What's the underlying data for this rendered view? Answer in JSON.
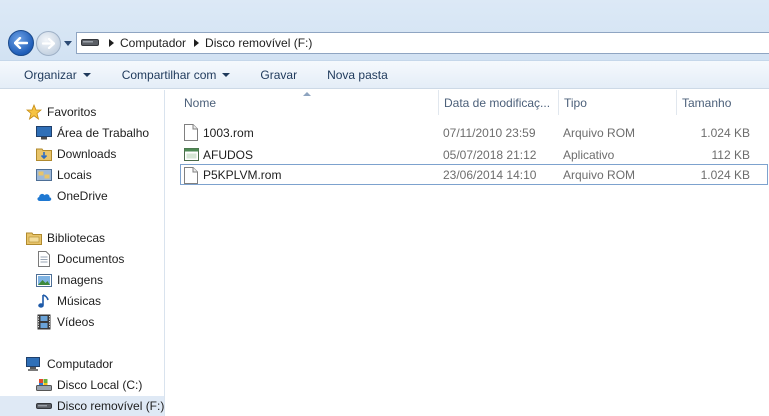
{
  "address": {
    "crumbs": [
      "Computador",
      "Disco removível (F:)"
    ]
  },
  "toolbar": {
    "organize": "Organizar",
    "share": "Compartilhar com",
    "burn": "Gravar",
    "new_folder": "Nova pasta"
  },
  "nav": {
    "favorites": "Favoritos",
    "desktop": "Área de Trabalho",
    "downloads": "Downloads",
    "places": "Locais",
    "onedrive": "OneDrive",
    "libraries": "Bibliotecas",
    "documents": "Documentos",
    "pictures": "Imagens",
    "music": "Músicas",
    "videos": "Vídeos",
    "computer": "Computador",
    "local_disk": "Disco Local (C:)",
    "removable": "Disco removível (F:)"
  },
  "columns": {
    "name": "Nome",
    "date": "Data de modificaç...",
    "type": "Tipo",
    "size": "Tamanho"
  },
  "files": [
    {
      "name": "1003.rom",
      "date": "07/11/2010 23:59",
      "type": "Arquivo ROM",
      "size": "1.024 KB",
      "icon": "document-icon"
    },
    {
      "name": "AFUDOS",
      "date": "05/07/2018 21:12",
      "type": "Aplicativo",
      "size": "112 KB",
      "icon": "application-icon"
    },
    {
      "name": "P5KPLVM.rom",
      "date": "23/06/2014 14:10",
      "type": "Arquivo ROM",
      "size": "1.024 KB",
      "icon": "document-icon"
    }
  ]
}
